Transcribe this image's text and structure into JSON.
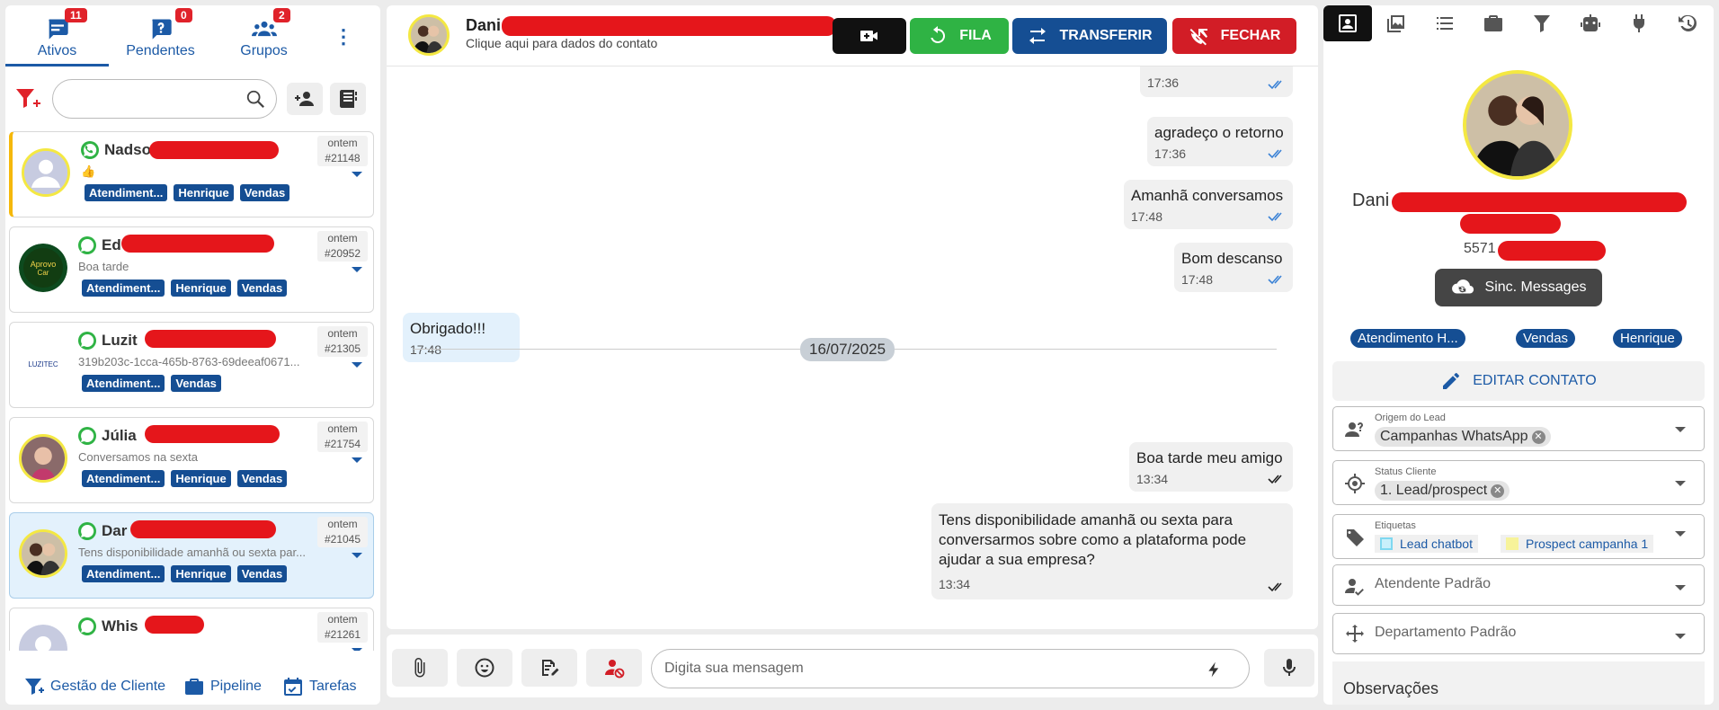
{
  "left": {
    "tabs": [
      {
        "label": "Ativos",
        "badge": "11"
      },
      {
        "label": "Pendentes",
        "badge": "0"
      },
      {
        "label": "Grupos",
        "badge": "2"
      }
    ],
    "conversations": [
      {
        "name": "Nadso",
        "preview": "👍",
        "time": "ontem",
        "id": "#21148",
        "tags": [
          "Atendiment...",
          "Henrique",
          "Vendas"
        ]
      },
      {
        "name": "Ed",
        "preview": "Boa tarde",
        "time": "ontem",
        "id": "#20952",
        "tags": [
          "Atendiment...",
          "Henrique",
          "Vendas"
        ]
      },
      {
        "name": "Luzit",
        "preview": "319b203c-1cca-465b-8763-69deeaf0671...",
        "time": "ontem",
        "id": "#21305",
        "tags": [
          "Atendiment...",
          "Vendas"
        ]
      },
      {
        "name": "Júlia",
        "preview": "Conversamos na sexta",
        "time": "ontem",
        "id": "#21754",
        "tags": [
          "Atendiment...",
          "Henrique",
          "Vendas"
        ]
      },
      {
        "name": "Dar",
        "preview": "Tens disponibilidade amanhã ou sexta par...",
        "time": "ontem",
        "id": "#21045",
        "tags": [
          "Atendiment...",
          "Henrique",
          "Vendas"
        ]
      },
      {
        "name": "Whis",
        "preview": "",
        "time": "ontem",
        "id": "#21261",
        "tags": []
      }
    ],
    "footer": {
      "gestao": "Gestão de Cliente",
      "pipeline": "Pipeline",
      "tarefas": "Tarefas"
    }
  },
  "chat": {
    "contact_name": "Dani",
    "contact_sub": "Clique aqui para dados do contato",
    "buttons": {
      "fila": "FILA",
      "transferir": "TRANSFERIR",
      "fechar": "FECHAR"
    },
    "messages": [
      {
        "dir": "out",
        "text": "",
        "time": "17:36"
      },
      {
        "dir": "out",
        "text": "agradeço o retorno",
        "time": "17:36"
      },
      {
        "dir": "out",
        "text": "Amanhã conversamos",
        "time": "17:48"
      },
      {
        "dir": "out",
        "text": "Bom descanso",
        "time": "17:48"
      },
      {
        "dir": "in",
        "text": "Obrigado!!!",
        "time": "17:48"
      },
      {
        "dir": "out",
        "text": "Boa tarde meu amigo",
        "time": "13:34"
      },
      {
        "dir": "out",
        "text": "Tens disponibilidade amanhã ou sexta para conversarmos sobre como a plataforma pode ajudar a sua empresa?",
        "time": "13:34"
      }
    ],
    "date_separator": "16/07/2025",
    "input_placeholder": "Digita sua mensagem"
  },
  "contact": {
    "name": "Dani",
    "phone": "5571",
    "sync_label": "Sinc. Messages",
    "tags": [
      "Atendimento H...",
      "Vendas",
      "Henrique"
    ],
    "edit_label": "EDITAR CONTATO",
    "origem": {
      "label": "Origem do Lead",
      "value": "Campanhas WhatsApp"
    },
    "status": {
      "label": "Status Cliente",
      "value": "1. Lead/prospect"
    },
    "etiquetas": {
      "label": "Etiquetas",
      "values": [
        "Lead chatbot",
        "Prospect campanha 1"
      ]
    },
    "atendente": "Atendente Padrão",
    "departamento": "Departamento Padrão",
    "observacoes": "Observações"
  },
  "colors": {
    "primary": "#1c5aa6",
    "tag": "#154e93",
    "fila": "#2fb344",
    "transferir": "#154e93",
    "fechar": "#d21d26",
    "video": "#111111"
  }
}
